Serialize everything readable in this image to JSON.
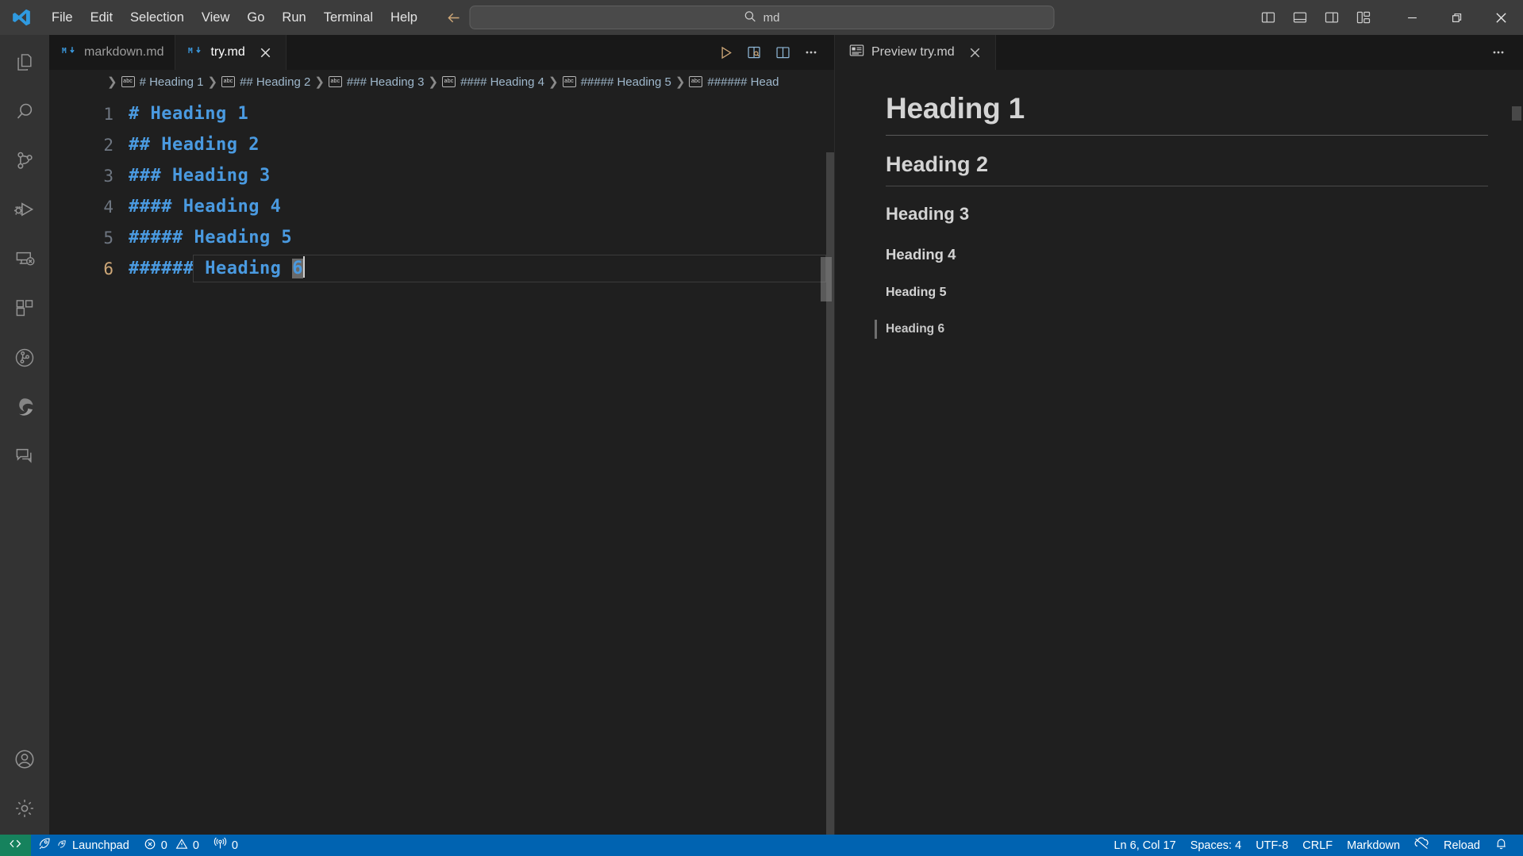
{
  "titlebar": {
    "logo_icon": "vscode-logo-icon",
    "menus": [
      "File",
      "Edit",
      "Selection",
      "View",
      "Go",
      "Run",
      "Terminal",
      "Help"
    ],
    "nav": {
      "back_icon": "arrow-left-icon",
      "forward_icon": "arrow-right-icon"
    },
    "command_center": {
      "search_icon": "search-icon",
      "value": "md",
      "placeholder": "Search"
    },
    "layout_icons": [
      "toggle-primary-sidebar-icon",
      "toggle-panel-icon",
      "toggle-secondary-sidebar-icon",
      "customize-layout-icon"
    ],
    "window_controls": [
      "minimize-icon",
      "restore-icon",
      "close-icon"
    ]
  },
  "activitybar": {
    "items": [
      {
        "name": "explorer",
        "icon": "files-icon"
      },
      {
        "name": "search",
        "icon": "search-icon"
      },
      {
        "name": "source-control",
        "icon": "source-control-icon"
      },
      {
        "name": "run-and-debug",
        "icon": "run-debug-icon"
      },
      {
        "name": "remote-explorer",
        "icon": "remote-explorer-icon"
      },
      {
        "name": "extensions",
        "icon": "extensions-icon"
      },
      {
        "name": "git-graph",
        "icon": "git-graph-icon"
      },
      {
        "name": "browser-preview",
        "icon": "edge-browser-icon"
      },
      {
        "name": "chat",
        "icon": "chat-icon"
      }
    ],
    "bottom_items": [
      {
        "name": "accounts",
        "icon": "account-icon"
      },
      {
        "name": "settings",
        "icon": "gear-icon"
      }
    ]
  },
  "editor": {
    "tabs": [
      {
        "label": "markdown.md",
        "icon": "markdown-file-icon",
        "active": false,
        "closable": false
      },
      {
        "label": "try.md",
        "icon": "markdown-file-icon",
        "active": true,
        "closable": true,
        "close_icon": "close-icon"
      }
    ],
    "actions": [
      {
        "name": "run-icon",
        "title": "Run"
      },
      {
        "name": "open-preview-to-side-icon",
        "title": "Open Preview to the Side"
      },
      {
        "name": "split-editor-icon",
        "title": "Split Editor Right"
      },
      {
        "name": "more-actions-icon",
        "title": "More Actions..."
      }
    ],
    "breadcrumbs": [
      {
        "symbol_icon": "symbol-string-icon",
        "symbol_label": "abc",
        "text": "# Heading 1"
      },
      {
        "symbol_icon": "symbol-string-icon",
        "symbol_label": "abc",
        "text": "## Heading 2"
      },
      {
        "symbol_icon": "symbol-string-icon",
        "symbol_label": "abc",
        "text": "### Heading 3"
      },
      {
        "symbol_icon": "symbol-string-icon",
        "symbol_label": "abc",
        "text": "#### Heading 4"
      },
      {
        "symbol_icon": "symbol-string-icon",
        "symbol_label": "abc",
        "text": "##### Heading 5"
      },
      {
        "symbol_icon": "symbol-string-icon",
        "symbol_label": "abc",
        "text": "###### Head"
      }
    ],
    "lines": [
      {
        "number": "1",
        "text": "# Heading 1"
      },
      {
        "number": "2",
        "text": "## Heading 2"
      },
      {
        "number": "3",
        "text": "### Heading 3"
      },
      {
        "number": "4",
        "text": "#### Heading 4"
      },
      {
        "number": "5",
        "text": "##### Heading 5"
      },
      {
        "number": "6",
        "text": "###### Heading ",
        "selected_text": "6",
        "current": true
      }
    ]
  },
  "preview": {
    "tab": {
      "label": "Preview try.md",
      "icon": "preview-icon",
      "close_icon": "close-icon"
    },
    "more_actions_icon": "more-actions-icon",
    "headings": [
      {
        "level": 1,
        "text": "Heading 1"
      },
      {
        "level": 2,
        "text": "Heading 2"
      },
      {
        "level": 3,
        "text": "Heading 3"
      },
      {
        "level": 4,
        "text": "Heading 4"
      },
      {
        "level": 5,
        "text": "Heading 5"
      },
      {
        "level": 6,
        "text": "Heading 6"
      }
    ]
  },
  "statusbar": {
    "remote_icon": "remote-window-icon",
    "left": [
      {
        "name": "launchpad",
        "label": "Launchpad",
        "icon": "rocket-icon",
        "icon2": "rocket-small-icon"
      },
      {
        "name": "problems",
        "label_error": "0",
        "label_warning": "0",
        "error_icon": "error-icon",
        "warning_icon": "warning-icon"
      },
      {
        "name": "ports",
        "label": "0",
        "icon": "radio-tower-icon"
      }
    ],
    "right": [
      {
        "name": "editor-position",
        "label": "Ln 6, Col 17"
      },
      {
        "name": "indentation",
        "label": "Spaces: 4"
      },
      {
        "name": "encoding",
        "label": "UTF-8"
      },
      {
        "name": "eol",
        "label": "CRLF"
      },
      {
        "name": "language-mode",
        "label": "Markdown"
      },
      {
        "name": "prettier-status",
        "icon": "prettier-disabled-icon"
      },
      {
        "name": "reload",
        "label": "Reload"
      },
      {
        "name": "notifications",
        "icon": "bell-icon"
      }
    ]
  },
  "colors": {
    "titlebar_bg": "#3c3c3c",
    "activitybar_bg": "#333333",
    "editor_bg": "#1f1f1f",
    "tabsbar_bg": "#181818",
    "statusbar_bg": "#0063b1",
    "remote_bg": "#16825d",
    "markdown_heading": "#4a9ae0",
    "text_primary": "#d4d4d4"
  }
}
